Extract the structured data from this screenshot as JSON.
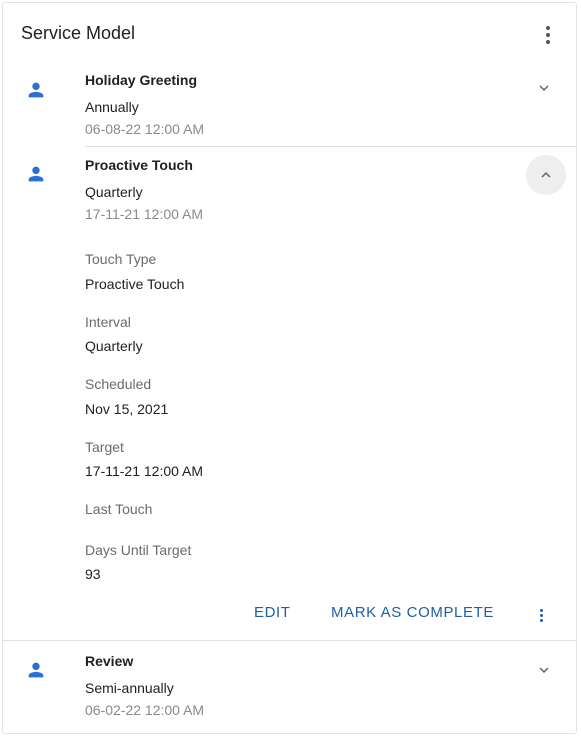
{
  "header": {
    "title": "Service Model"
  },
  "items": [
    {
      "title": "Holiday Greeting",
      "interval": "Annually",
      "date": "06-08-22 12:00 AM",
      "expanded": false
    },
    {
      "title": "Proactive Touch",
      "interval": "Quarterly",
      "date": "17-11-21 12:00 AM",
      "expanded": true,
      "details": [
        {
          "label": "Touch Type",
          "value": "Proactive Touch"
        },
        {
          "label": "Interval",
          "value": "Quarterly"
        },
        {
          "label": "Scheduled",
          "value": "Nov 15, 2021"
        },
        {
          "label": "Target",
          "value": "17-11-21 12:00 AM"
        },
        {
          "label": "Last Touch",
          "value": ""
        },
        {
          "label": "Days Until Target",
          "value": "93"
        }
      ],
      "actions": {
        "edit_label": "EDIT",
        "complete_label": "MARK AS COMPLETE"
      }
    },
    {
      "title": "Review",
      "interval": "Semi-annually",
      "date": "06-02-22 12:00 AM",
      "expanded": false
    }
  ],
  "colors": {
    "accent": "#1f5fa3",
    "person_icon": "#2b6fd6",
    "muted_text": "#8a8a8a"
  },
  "icons": [
    "person-icon",
    "chevron-down-icon",
    "chevron-up-icon",
    "more-vert-icon"
  ]
}
